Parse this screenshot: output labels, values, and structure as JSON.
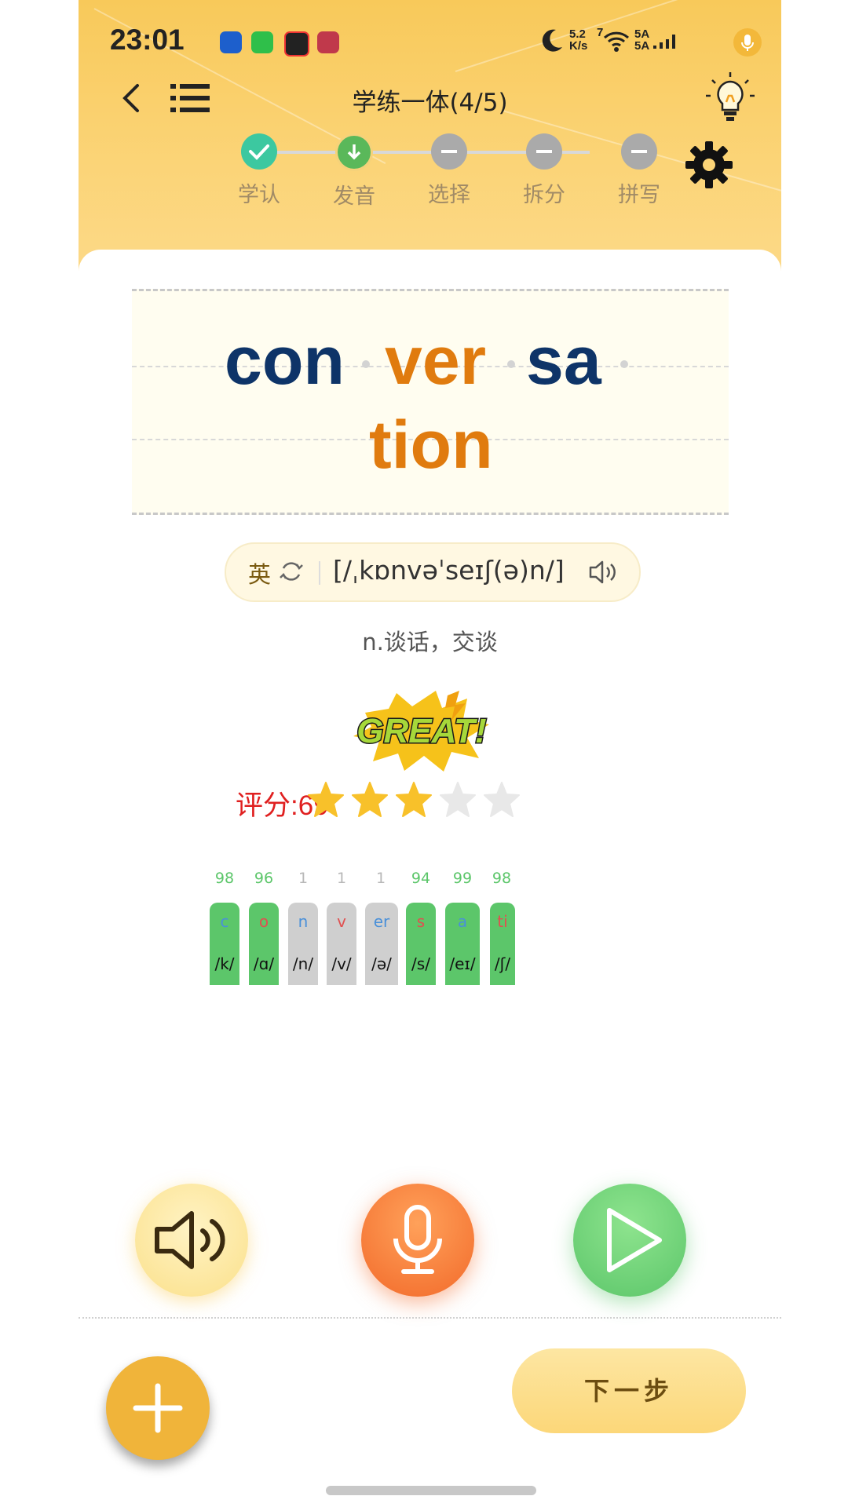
{
  "status_bar": {
    "time": "23:01",
    "net_speed_top": "5.2",
    "net_speed_bottom": "K/s",
    "wifi_label": "7",
    "signal_1": "5A",
    "signal_2": "5A"
  },
  "nav": {
    "title": "学练一体(4/5)"
  },
  "steps": [
    {
      "label": "学认",
      "state": "done"
    },
    {
      "label": "发音",
      "state": "current"
    },
    {
      "label": "选择",
      "state": "todo"
    },
    {
      "label": "拆分",
      "state": "todo"
    },
    {
      "label": "拼写",
      "state": "todo"
    }
  ],
  "word": {
    "syllables": [
      "con",
      "ver",
      "sa",
      "tion"
    ]
  },
  "phonetic": {
    "lang": "英",
    "ipa": "[/ˌkɒnvəˈseɪʃ(ə)n/]"
  },
  "meaning": "n.谈话，交谈",
  "badge_text": "GREAT!",
  "score": {
    "label": "评分:69",
    "stars_filled": 3,
    "stars_total": 5
  },
  "phonemes": [
    {
      "score": "98",
      "grapheme": "c",
      "ipa": "/k/",
      "status": "good"
    },
    {
      "score": "96",
      "grapheme": "o",
      "ipa": "/ɑ/",
      "status": "good"
    },
    {
      "score": "1",
      "grapheme": "n",
      "ipa": "/n/",
      "status": "bad"
    },
    {
      "score": "1",
      "grapheme": "v",
      "ipa": "/v/",
      "status": "bad"
    },
    {
      "score": "1",
      "grapheme": "er",
      "ipa": "/ə/",
      "status": "bad"
    },
    {
      "score": "94",
      "grapheme": "s",
      "ipa": "/s/",
      "status": "good"
    },
    {
      "score": "99",
      "grapheme": "a",
      "ipa": "/eɪ/",
      "status": "good"
    },
    {
      "score": "98",
      "grapheme": "ti",
      "ipa": "/ʃ/",
      "status": "good"
    }
  ],
  "buttons": {
    "next_label": "下一步"
  },
  "colors": {
    "header_yellow": "#f8c95a",
    "good_green": "#5cc66a",
    "bad_gray": "#cfcfcf",
    "navy": "#0e3468",
    "orange": "#e07b0e",
    "score_red": "#e02020"
  }
}
